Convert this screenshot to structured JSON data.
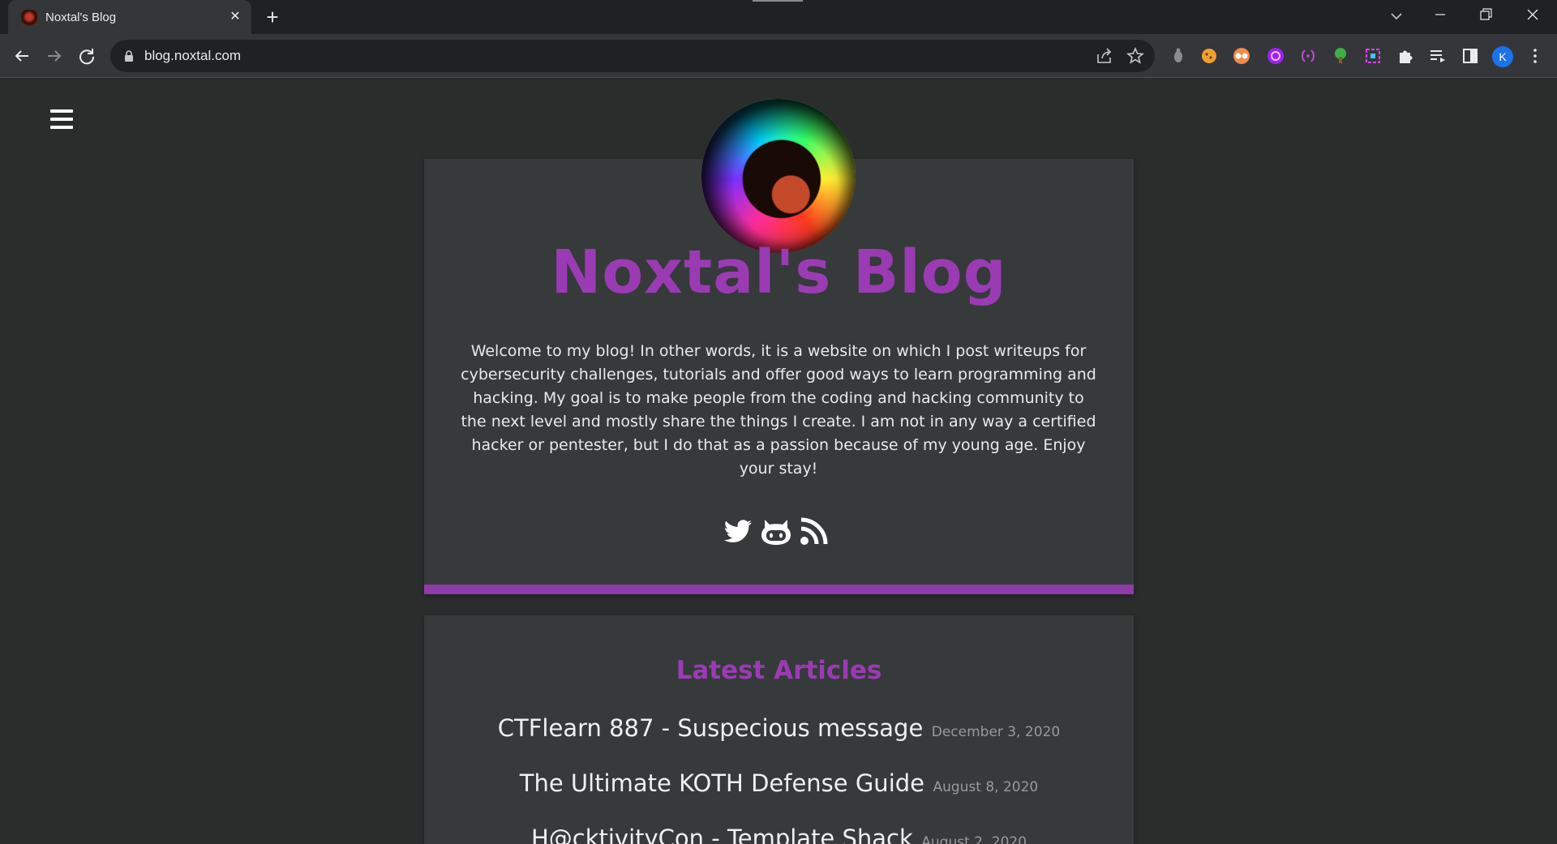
{
  "browser": {
    "tab_title": "Noxtal's Blog",
    "url": "blog.noxtal.com",
    "profile_initial": "K",
    "extensions": [
      "extension-icon",
      "cookie-icon",
      "glasses-icon",
      "purple-circle-icon",
      "brackets-icon",
      "tree-icon",
      "color-picker-icon"
    ]
  },
  "site": {
    "title": "Noxtal's Blog",
    "intro": "Welcome to my blog! In other words, it is a website on which I post writeups for cybersecurity challenges, tutorials and offer good ways to learn programming and hacking. My goal is to make people from the coding and hacking community to the next level and mostly share the things I create. I am not in any way a certified hacker or pentester, but I do that as a passion because of my young age. Enjoy your stay!",
    "socials": [
      "twitter-icon",
      "github-icon",
      "rss-icon"
    ],
    "accent_color": "#9b3bb4"
  },
  "articles": {
    "heading": "Latest Articles",
    "items": [
      {
        "title": "CTFlearn 887 - Suspecious message",
        "date": "December 3, 2020"
      },
      {
        "title": "The Ultimate KOTH Defense Guide",
        "date": "August 8, 2020"
      },
      {
        "title": "H@cktivityCon - Template Shack",
        "date": "August 2, 2020"
      }
    ]
  }
}
